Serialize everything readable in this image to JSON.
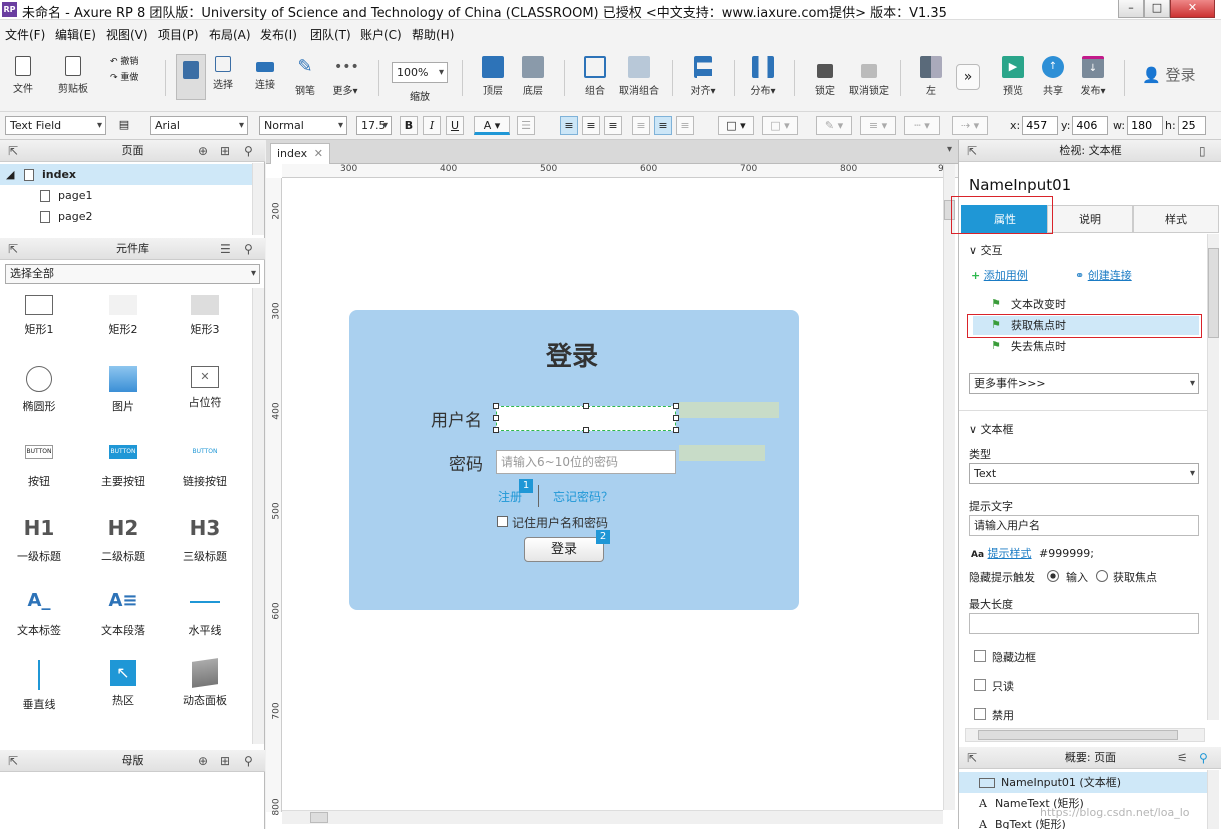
{
  "window": {
    "title": "未命名 - Axure RP 8 团队版：University of Science and Technology of China (CLASSROOM) 已授权     <中文支持：www.iaxure.com提供> 版本：V1.35"
  },
  "menu": [
    "文件(F)",
    "编辑(E)",
    "视图(V)",
    "项目(P)",
    "布局(A)",
    "发布(I)",
    "团队(T)",
    "账户(C)",
    "帮助(H)"
  ],
  "toolbar": {
    "file": "文件",
    "clipboard": "剪贴板",
    "cut": "撤销",
    "redo": "重做",
    "select": "选择",
    "connect": "连接",
    "pen": "钢笔",
    "more": "更多▾",
    "zoom_value": "100%",
    "zoom": "缩放",
    "top": "顶层",
    "bottom": "底层",
    "group": "组合",
    "ungroup": "取消组合",
    "align": "对齐▾",
    "distribute": "分布▾",
    "lock": "锁定",
    "unlock": "取消锁定",
    "left": "左",
    "preview": "预览",
    "share": "共享",
    "publish": "发布▾",
    "login": "登录"
  },
  "format": {
    "widget_type": "Text Field",
    "font": "Arial",
    "style": "Normal",
    "size": "17.5",
    "bold": "B",
    "italic": "I",
    "underline": "U",
    "textcolor": "A",
    "x_label": "x:",
    "x": "457",
    "y_label": "y:",
    "y": "406",
    "w_label": "w:",
    "w": "180",
    "h_label": "h:",
    "h": "25"
  },
  "pages_panel": {
    "title": "页面",
    "items": [
      {
        "label": "index",
        "selected": true
      },
      {
        "label": "page1"
      },
      {
        "label": "page2"
      }
    ]
  },
  "library_panel": {
    "title": "元件库",
    "select": "选择全部",
    "widgets": [
      "矩形1",
      "矩形2",
      "矩形3",
      "椭圆形",
      "图片",
      "占位符",
      "按钮",
      "主要按钮",
      "链接按钮",
      "一级标题",
      "二级标题",
      "三级标题",
      "文本标签",
      "文本段落",
      "水平线",
      "垂直线",
      "热区",
      "动态面板"
    ],
    "button_text": "BUTTON",
    "h1": "H1",
    "h2": "H2",
    "h3": "H3"
  },
  "masters_panel": {
    "title": "母版"
  },
  "canvas": {
    "tab": "index",
    "ruler_h": [
      "300",
      "400",
      "500",
      "600",
      "700",
      "800",
      "900"
    ],
    "ruler_v": [
      "200",
      "300",
      "400",
      "500",
      "600",
      "700",
      "800"
    ],
    "login_title": "登录",
    "username_label": "用户名",
    "password_label": "密码",
    "password_placeholder": "请输入6~10位的密码",
    "register": "注册",
    "forgot": "忘记密码？",
    "remember": "记住用户名和密码",
    "login_button": "登录",
    "badge1": "1",
    "badge2": "2"
  },
  "inspector": {
    "header": "检视: 文本框",
    "name": "NameInput01",
    "tabs": [
      "属性",
      "说明",
      "样式"
    ],
    "interaction": "交互",
    "add_case": "添加用例",
    "create_link": "创建连接",
    "events": [
      "文本改变时",
      "获取焦点时",
      "失去焦点时"
    ],
    "more_events": "更多事件>>>",
    "textbox_section": "文本框",
    "type_label": "类型",
    "type_value": "Text",
    "hint_label": "提示文字",
    "hint_value": "请输入用户名",
    "hint_style": "提示样式",
    "hint_color": "#999999;",
    "hide_hint": "隐藏提示触发",
    "hide_input": "输入",
    "hide_focus": "获取焦点",
    "maxlen": "最大长度",
    "hide_border": "隐藏边框",
    "readonly": "只读",
    "disabled": "禁用"
  },
  "outline": {
    "header": "概要: 页面",
    "items": [
      "NameInput01 (文本框)",
      "NameText (矩形)",
      "BgText (矩形)"
    ]
  },
  "watermark": "https://blog.csdn.net/loa_lo"
}
